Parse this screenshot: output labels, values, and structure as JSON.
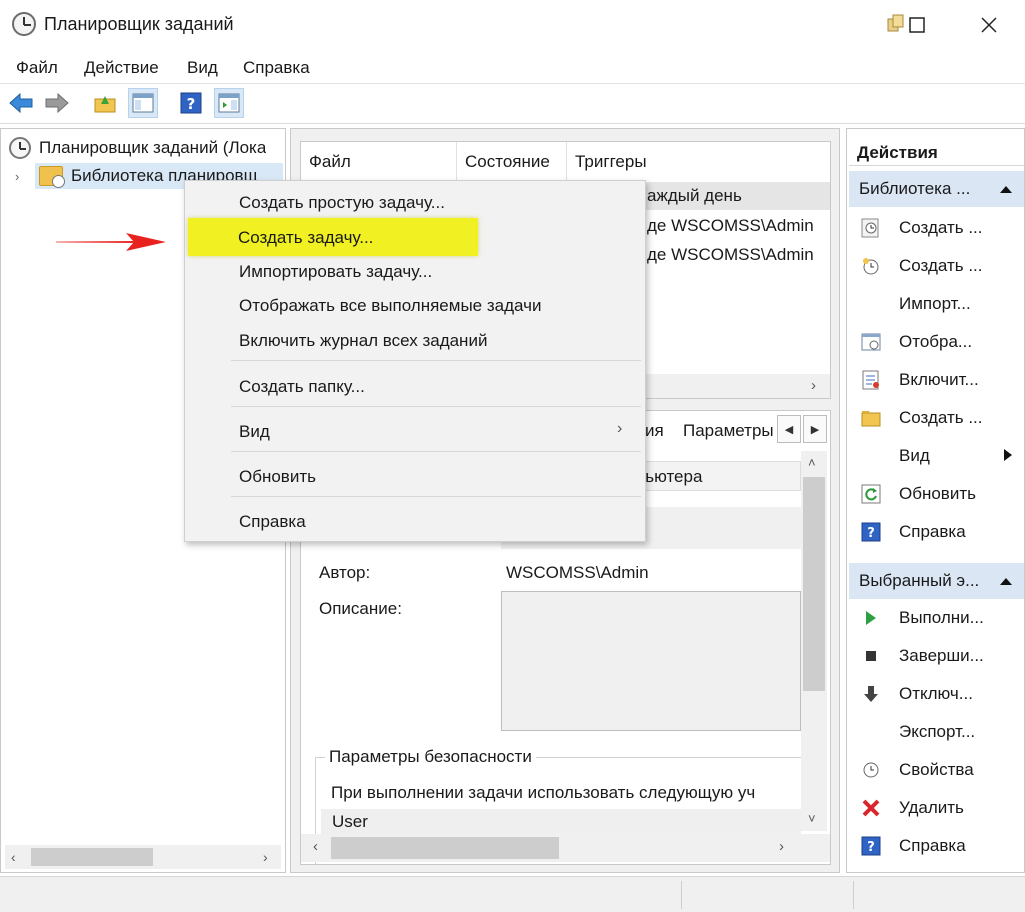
{
  "window": {
    "title": "Планировщик заданий"
  },
  "menu": [
    "Файл",
    "Действие",
    "Вид",
    "Справка"
  ],
  "tree": {
    "root": "Планировщик заданий (Лока",
    "library": "Библиотека планировщ"
  },
  "task_list": {
    "columns": [
      "Файл",
      "Состояние",
      "Триггеры"
    ],
    "rows": [
      {
        "trigger": "аждый день"
      },
      {
        "trigger": "де WSCOMSS\\Admin"
      },
      {
        "trigger": "де WSCOMSS\\Admin"
      }
    ]
  },
  "detail": {
    "tabs": [
      "ия",
      "Параметры"
    ],
    "location_value": "пьютера",
    "author_label": "Автор:",
    "author_value": "WSCOMSS\\Admin",
    "description_label": "Описание:",
    "security_group": "Параметры безопасности",
    "security_text": "При выполнении задачи использовать следующую уч",
    "user_value": "User"
  },
  "actions": {
    "title": "Действия",
    "group1": "Библиотека ...",
    "group1_items": [
      {
        "label": "Создать ...",
        "icon": "create-basic-task-icon"
      },
      {
        "label": "Создать ...",
        "icon": "create-task-icon"
      },
      {
        "label": "Импорт...",
        "icon": ""
      },
      {
        "label": "Отобра...",
        "icon": "display-running-icon"
      },
      {
        "label": "Включит...",
        "icon": "enable-history-icon"
      },
      {
        "label": "Создать ...",
        "icon": "new-folder-icon"
      },
      {
        "label": "Вид",
        "icon": ""
      },
      {
        "label": "Обновить",
        "icon": "refresh-icon"
      },
      {
        "label": "Справка",
        "icon": "help-icon"
      }
    ],
    "group2": "Выбранный э...",
    "group2_items": [
      {
        "label": "Выполни...",
        "icon": "run-icon"
      },
      {
        "label": "Заверши...",
        "icon": "end-icon"
      },
      {
        "label": "Отключ...",
        "icon": "disable-icon"
      },
      {
        "label": "Экспорт...",
        "icon": ""
      },
      {
        "label": "Свойства",
        "icon": "properties-icon"
      },
      {
        "label": "Удалить",
        "icon": "delete-icon"
      },
      {
        "label": "Справка",
        "icon": "help-icon"
      }
    ]
  },
  "context_menu": {
    "items": [
      "Создать простую задачу...",
      "Создать задачу...",
      "Импортировать задачу...",
      "Отображать все выполняемые задачи",
      "Включить журнал всех заданий",
      "Создать папку...",
      "Вид",
      "Обновить",
      "Справка"
    ],
    "highlight_color": "#f1f022"
  },
  "annotation": {
    "arrow_color": "#e8231f"
  }
}
